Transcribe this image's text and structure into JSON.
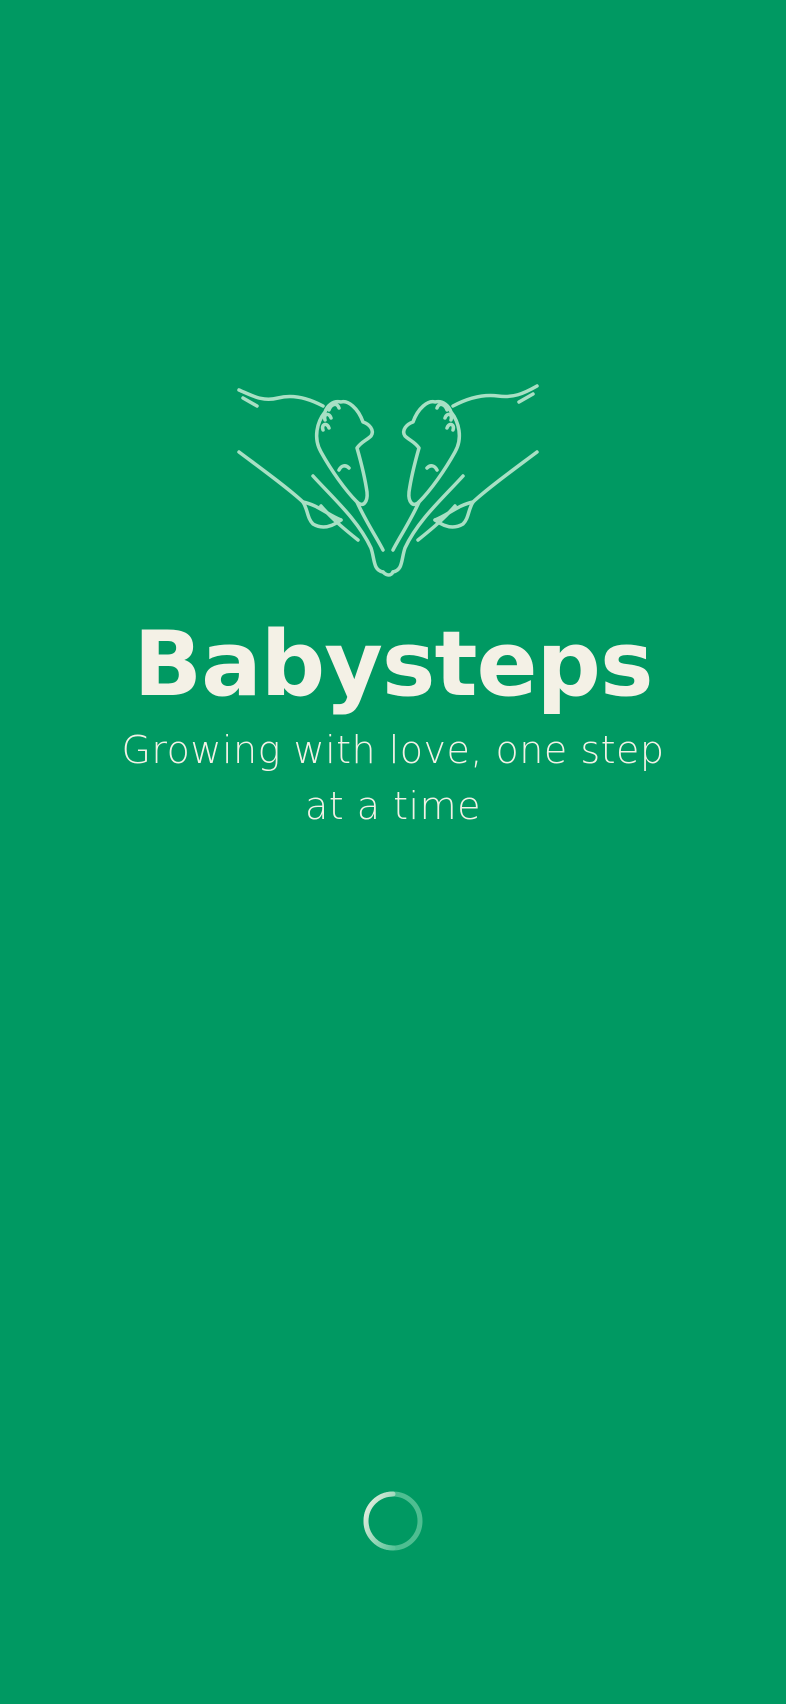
{
  "app": {
    "title": "Babysteps",
    "tagline": "Growing with love, one step at a time"
  },
  "logo": {
    "icon": "hands-holding-baby-feet-icon",
    "stroke_color": "#a8e0c4"
  },
  "loading": {
    "icon": "loading-spinner-icon"
  },
  "colors": {
    "background": "#009962",
    "text": "#f4f1e6",
    "accent": "#a8e0c4"
  }
}
